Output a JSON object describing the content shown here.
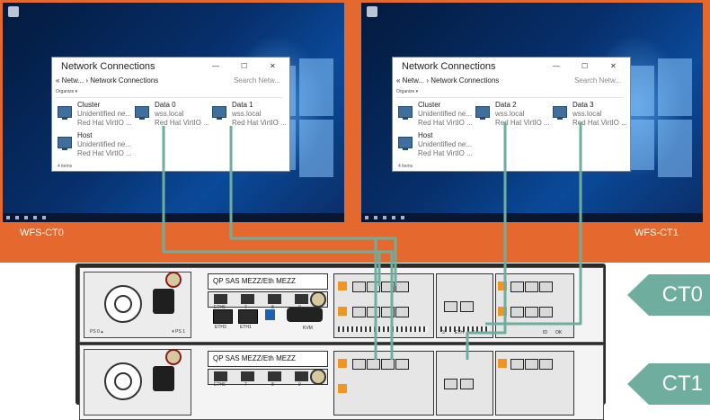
{
  "left_host": {
    "label": "WFS-CT0",
    "window": {
      "title": "Network Connections",
      "address": "« Netw... › Network Connections",
      "search": "Search Netw...",
      "organize": "Organize ▾",
      "status": "4 items",
      "items": [
        {
          "name": "Cluster",
          "line2": "Unidentified ne...",
          "line3": "Red Hat VirtIO ..."
        },
        {
          "name": "Data 0",
          "line2": "wss.local",
          "line3": "Red Hat VirtIO ..."
        },
        {
          "name": "Data 1",
          "line2": "wss.local",
          "line3": "Red Hat VirtIO ..."
        },
        {
          "name": "Host",
          "line2": "Unidentified ne...",
          "line3": "Red Hat VirtIO ..."
        }
      ]
    }
  },
  "right_host": {
    "label": "WFS-CT1",
    "window": {
      "title": "Network Connections",
      "address": "« Netw... › Network Connections",
      "search": "Search Netw...",
      "organize": "Organize ▾",
      "status": "4 items",
      "items": [
        {
          "name": "Cluster",
          "line2": "Unidentified ne...",
          "line3": "Red Hat VirtIO ..."
        },
        {
          "name": "Data 2",
          "line2": "wss.local",
          "line3": "Red Hat VirtIO ..."
        },
        {
          "name": "Data 3",
          "line2": "wss.local",
          "line3": "Red Hat VirtIO ..."
        },
        {
          "name": "Host",
          "line2": "Unidentified ne...",
          "line3": "Red Hat VirtIO ..."
        }
      ]
    }
  },
  "chassis": {
    "mezz_label": "QP SAS MEZZ/Eth MEZZ",
    "eth_ports": [
      "ETH6",
      "7",
      "8",
      "9"
    ],
    "rj45": [
      "ETH3",
      "ETH1"
    ],
    "kvm": "KVM",
    "ps0": "PS 0 ▴",
    "ps1": "▾ PS 1",
    "slot_labels": [
      "3",
      "ETH",
      "5",
      "ID",
      "OK"
    ]
  },
  "controllers": [
    "CT0",
    "CT1"
  ],
  "colors": {
    "band": "#e5692f",
    "cable": "#6fae9f",
    "arrow": "#6fae9f"
  }
}
